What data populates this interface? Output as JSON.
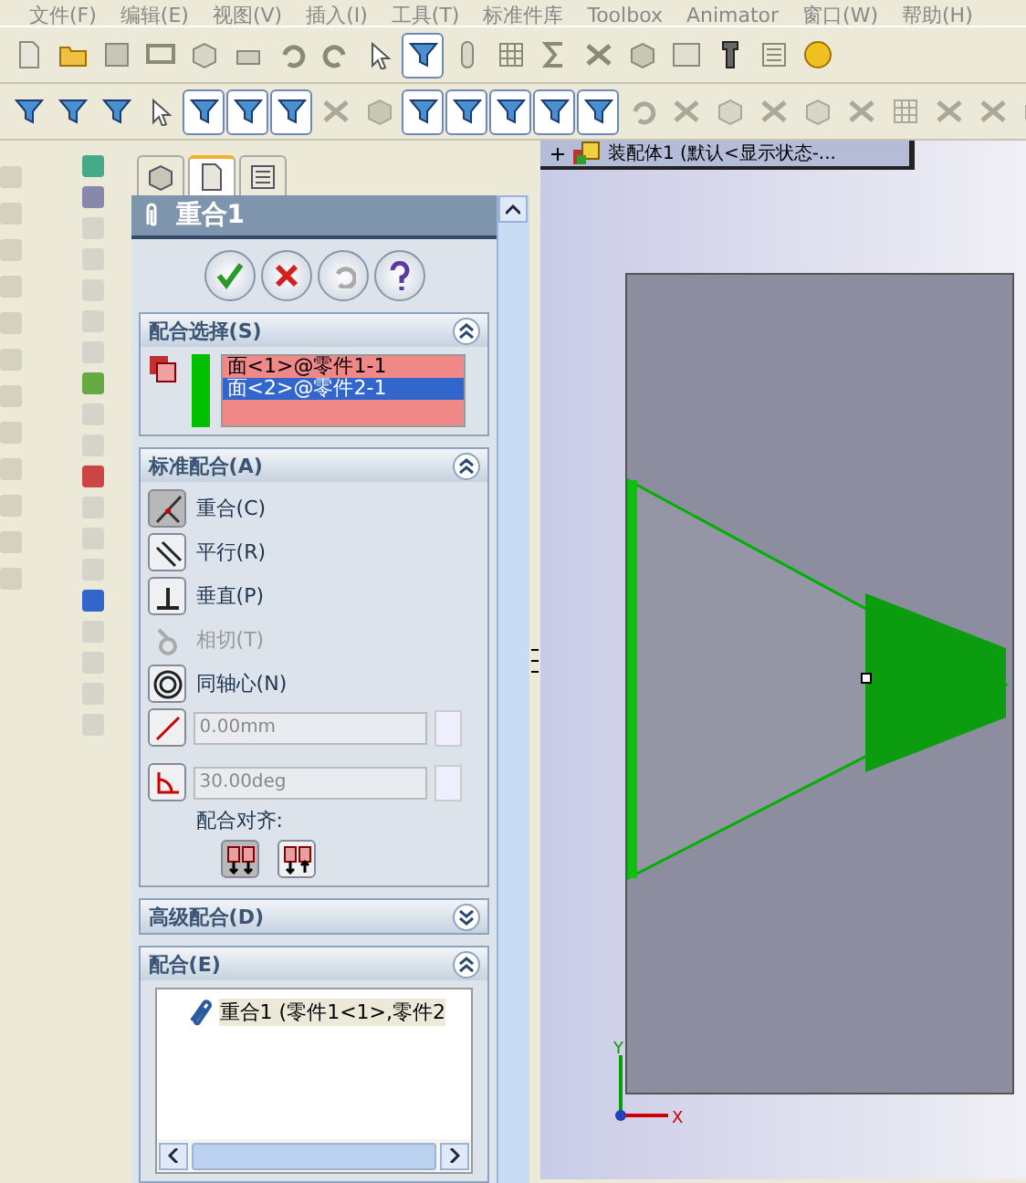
{
  "menu_bar": [
    "文件(F)",
    "编辑(E)",
    "视图(V)",
    "插入(I)",
    "工具(T)",
    "标准件库",
    "Toolbox",
    "Animator",
    "窗口(W)",
    "帮助(H)"
  ],
  "toolbar_1": [
    {
      "pressed": false
    },
    {
      "pressed": false
    },
    {
      "pressed": false
    },
    {
      "pressed": false
    },
    {
      "pressed": false
    },
    {
      "pressed": false
    },
    {
      "pressed": false
    },
    {
      "pressed": false
    },
    {
      "pressed": false
    },
    {
      "pressed": true
    },
    {
      "pressed": false
    },
    {
      "pressed": false
    },
    {
      "pressed": false
    },
    {
      "pressed": false
    },
    {
      "pressed": false
    },
    {
      "pressed": false
    },
    {
      "pressed": false
    },
    {
      "pressed": false
    },
    {
      "pressed": false
    }
  ],
  "toolbar_2": [
    {
      "pressed": false
    },
    {
      "pressed": false
    },
    {
      "pressed": false
    },
    {
      "pressed": false
    },
    {
      "pressed": true
    },
    {
      "pressed": true
    },
    {
      "pressed": true
    },
    {
      "pressed": false
    },
    {
      "pressed": false
    },
    {
      "pressed": true
    },
    {
      "pressed": true
    },
    {
      "pressed": true
    },
    {
      "pressed": true
    },
    {
      "pressed": true
    },
    {
      "pressed": false
    },
    {
      "pressed": false
    },
    {
      "pressed": false
    },
    {
      "pressed": false
    },
    {
      "pressed": false
    },
    {
      "pressed": false
    },
    {
      "pressed": false
    },
    {
      "pressed": false
    },
    {
      "pressed": false
    },
    {
      "pressed": false
    }
  ],
  "manager_tabs": [
    {
      "selected": false
    },
    {
      "selected": true
    },
    {
      "selected": false
    }
  ],
  "property_manager": {
    "title": "重合1",
    "mate_selection": {
      "title": "配合选择(S)",
      "expanded": true,
      "items": [
        {
          "label": "面<1>@零件1-1",
          "selected": false
        },
        {
          "label": "面<2>@零件2-1",
          "selected": true
        }
      ]
    },
    "standard_mates": {
      "title": "标准配合(A)",
      "expanded": true,
      "options": [
        {
          "kind": "coincident",
          "label": "重合(C)",
          "selected": true,
          "disabled": false
        },
        {
          "kind": "parallel",
          "label": "平行(R)",
          "selected": false,
          "disabled": false
        },
        {
          "kind": "perpendicular",
          "label": "垂直(P)",
          "selected": false,
          "disabled": false
        },
        {
          "kind": "tangent",
          "label": "相切(T)",
          "selected": false,
          "disabled": true
        },
        {
          "kind": "concentric",
          "label": "同轴心(N)",
          "selected": false,
          "disabled": false
        }
      ],
      "distance": {
        "value": "0.00mm",
        "disabled": true
      },
      "angle": {
        "value": "30.00deg",
        "disabled": true
      },
      "alignment_label": "配合对齐:",
      "alignment": [
        {
          "kind": "aligned",
          "selected": true
        },
        {
          "kind": "anti_aligned",
          "selected": false
        }
      ]
    },
    "advanced_mates": {
      "title": "高级配合(D)",
      "expanded": false
    },
    "mates": {
      "title": "配合(E)",
      "expanded": true,
      "items": [
        "重合1 (零件1<1>,零件2"
      ]
    }
  },
  "feature_tree": {
    "root": "装配体1 (默认<显示状态-...",
    "expanded": false
  },
  "triad": {
    "x_label": "X",
    "y_label": "Y"
  }
}
